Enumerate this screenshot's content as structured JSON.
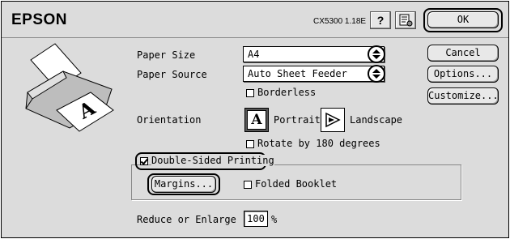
{
  "header": {
    "brand": "EPSON",
    "model": "CX5300 1.18E",
    "help_label": "?",
    "help_icon": "help-icon",
    "config_icon": "printer-config-icon"
  },
  "buttons": {
    "ok": "OK",
    "cancel": "Cancel",
    "options": "Options...",
    "customize": "Customize..."
  },
  "paper_size": {
    "label": "Paper Size",
    "value": "A4"
  },
  "paper_source": {
    "label": "Paper Source",
    "value": "Auto Sheet Feeder"
  },
  "borderless": {
    "label": "Borderless",
    "checked": false
  },
  "orientation": {
    "label": "Orientation",
    "portrait_label": "Portrait",
    "portrait_glyph": "A",
    "landscape_label": "Landscape",
    "selected": "Portrait"
  },
  "rotate": {
    "label": "Rotate by 180 degrees",
    "checked": false
  },
  "double_sided": {
    "label": "Double-Sided Printing",
    "checked": true
  },
  "margins_button": "Margins...",
  "folded_booklet": {
    "label": "Folded Booklet",
    "checked": false
  },
  "reduce": {
    "label": "Reduce or Enlarge",
    "value": "100",
    "unit": "%"
  },
  "illustration": {
    "glyph": "A"
  }
}
